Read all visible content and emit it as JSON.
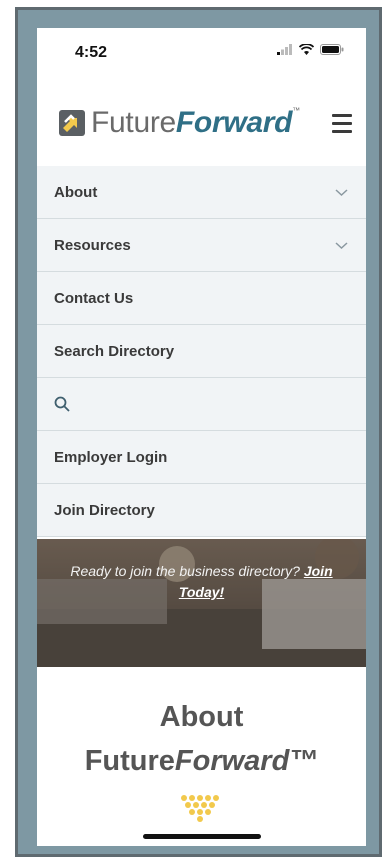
{
  "status": {
    "time": "4:52"
  },
  "header": {
    "logo_text_main": "Future",
    "logo_text_accent": "Forward",
    "logo_tm": "™"
  },
  "nav": {
    "items": [
      {
        "label": "About",
        "has_chevron": true
      },
      {
        "label": "Resources",
        "has_chevron": true
      },
      {
        "label": "Contact Us"
      },
      {
        "label": "Search Directory"
      },
      {
        "label": "",
        "icon": "search-icon"
      },
      {
        "label": "Employer Login"
      },
      {
        "label": "Join Directory"
      }
    ]
  },
  "hero": {
    "text": "Ready to join the business directory?",
    "link_part1": "Join",
    "link_part2": "Today!"
  },
  "about": {
    "title": "About",
    "brand_main": "Future",
    "brand_accent": "Forward™"
  },
  "colors": {
    "frame": "#7e98a3",
    "nav_bg": "#f1f4f6",
    "brand_blue": "#2f6f86",
    "accent_gold": "#f2c94c"
  }
}
